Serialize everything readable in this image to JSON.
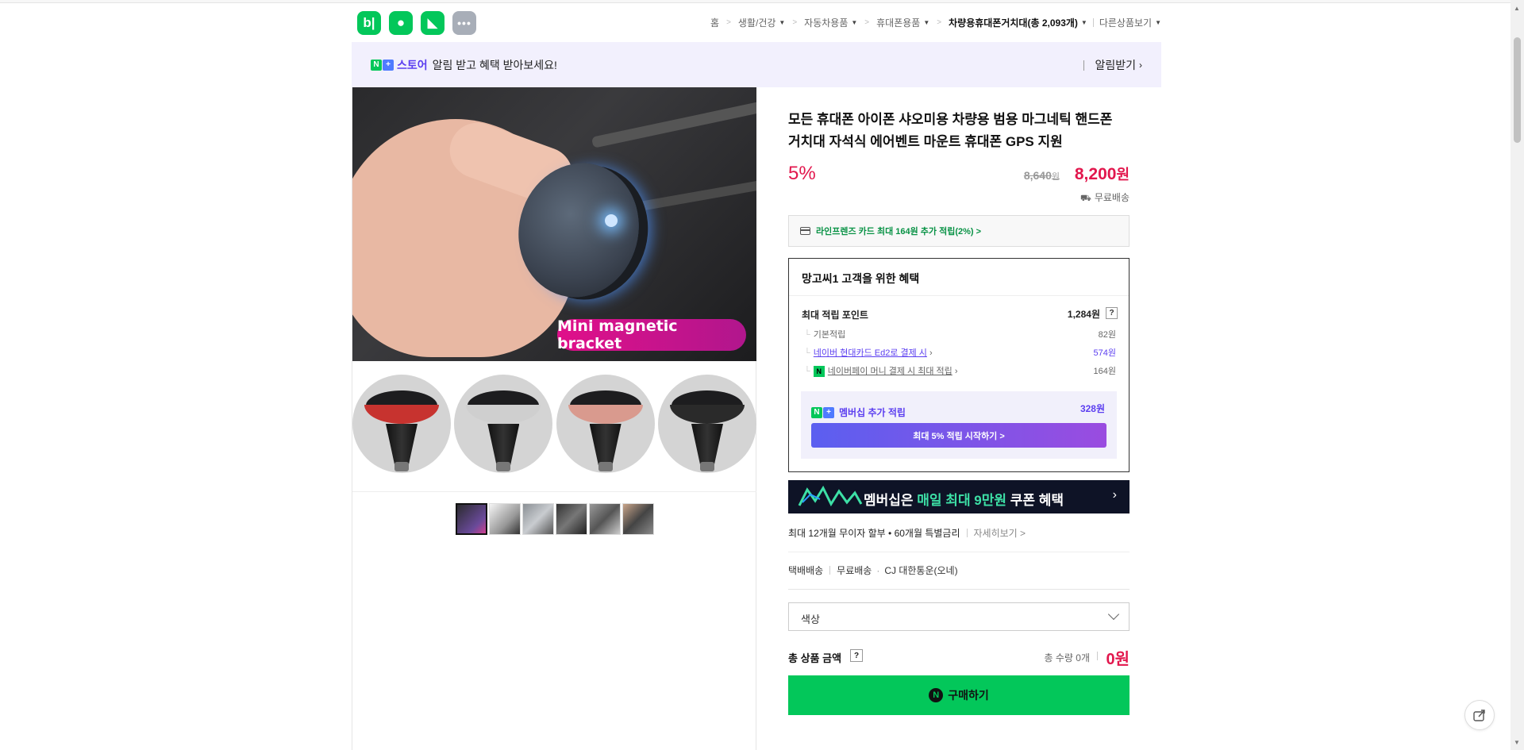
{
  "app_icons": [
    {
      "name": "blog-icon",
      "glyph": "b|"
    },
    {
      "name": "apple-icon",
      "glyph": "🍎"
    },
    {
      "name": "bookmark-icon",
      "glyph": "▶"
    },
    {
      "name": "more-icon",
      "glyph": "•••"
    }
  ],
  "breadcrumb": {
    "home": "홈",
    "items": [
      "생활/건강",
      "자동차용품",
      "휴대폰용품"
    ],
    "current": "차량용휴대폰거치대(총 2,093개)",
    "other": "다른상품보기"
  },
  "banner": {
    "store_label": "스토어",
    "message": "알림 받고 혜택 받아보세요!",
    "alarm_label": "알림받기"
  },
  "photo_label": "Mini magnetic bracket",
  "variants": [
    {
      "name": "red",
      "ring_color": "#c7332f"
    },
    {
      "name": "silver",
      "ring_color": "#cfcfcf"
    },
    {
      "name": "rose",
      "ring_color": "#d99a8e"
    },
    {
      "name": "black",
      "ring_color": "#2a2a2a"
    }
  ],
  "product": {
    "title": "모든 휴대폰 아이폰 샤오미용 차량용 범용 마그네틱 핸드폰 거치대 자석식 에어벤트 마운트 휴대폰 GPS 지원",
    "discount": "5%",
    "original_price": "8,640",
    "original_unit": "원",
    "price": "8,200",
    "price_unit": "원",
    "shipping": "무료배송"
  },
  "card_offer": "라인프렌즈 카드 최대 164원 추가 적립(2%) >",
  "benefit": {
    "title": "망고씨1 고객을 위한 혜택",
    "max_points_label": "최대 적립 포인트",
    "max_points": "1,284원",
    "rows": [
      {
        "label": "기본적립",
        "value": "82원"
      },
      {
        "label": "네이버 현대카드 Ed2로 결제 시",
        "value": "574원"
      },
      {
        "label": "네이버페이 머니 결제 시 최대 적립",
        "value": "164원"
      }
    ],
    "membership_label": "멤버십 추가 적립",
    "membership_value": "328원",
    "membership_button": "최대 5% 적립 시작하기 >"
  },
  "promo": {
    "text_a": "멤버십은 ",
    "text_b": "매일 최대 9만원",
    "text_c": " 쿠폰 혜택"
  },
  "installment": {
    "text": "최대 12개월 무이자 할부 • 60개월 특별금리",
    "more": "자세히보기 >"
  },
  "delivery": {
    "method": "택배배송",
    "fee": "무료배송",
    "courier": "CJ 대한통운(오네)"
  },
  "option_select": {
    "placeholder": "색상"
  },
  "total": {
    "label": "총 상품 금액",
    "quantity": "총 수량 0개",
    "amount": "0원"
  },
  "buy_button": "구매하기",
  "colors": {
    "naver_green": "#03c75a",
    "price_red": "#e2174d",
    "store_purple": "#5b3ef0"
  }
}
